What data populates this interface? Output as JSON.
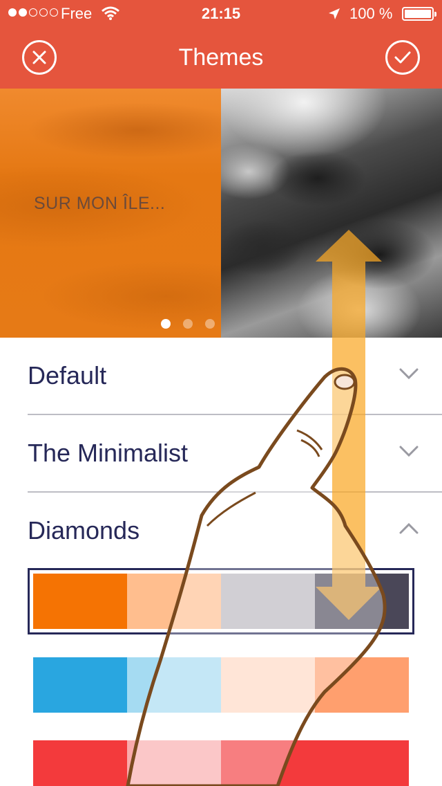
{
  "status_bar": {
    "signal_dots_filled": 2,
    "signal_dots_total": 5,
    "carrier": "Free",
    "time": "21:15",
    "battery": "100 %"
  },
  "header": {
    "title": "Themes",
    "close_icon": "close-circle-icon",
    "confirm_icon": "check-circle-icon",
    "color": "#E5553D"
  },
  "carousel": {
    "caption": "SUR MON ÎLE...",
    "page_count": 3,
    "active_page": 1
  },
  "themes": [
    {
      "label": "Default",
      "expanded": false,
      "chevron": "chevron-down-icon"
    },
    {
      "label": "The Minimalist",
      "expanded": false,
      "chevron": "chevron-down-icon"
    },
    {
      "label": "Diamonds",
      "expanded": true,
      "chevron": "chevron-up-icon"
    }
  ],
  "palettes": [
    {
      "selected": true,
      "colors": [
        "#F57303",
        "#FFBE8E",
        "#B8B6BE",
        "#4A4758"
      ]
    },
    {
      "selected": false,
      "colors": [
        "#29A6E0",
        "#A5DBF2",
        "#FFD7C2",
        "#FF9F6E"
      ]
    },
    {
      "selected": false,
      "colors": [
        "#F33A3C",
        "#F9AAAB",
        "#F33A3C",
        "#F33A3C"
      ]
    }
  ],
  "colors": {
    "text": "#262858",
    "divider": "#BDBDC4",
    "gesture_arrow": "#F9A825",
    "gesture_hand_outline": "#7A4A1E"
  }
}
